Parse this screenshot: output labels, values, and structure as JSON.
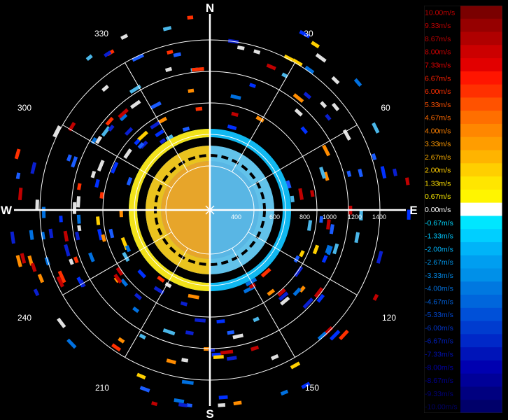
{
  "compass": {
    "north": "N",
    "east": "E",
    "south": "S",
    "west": "W"
  },
  "azimuth_labels": [
    "30",
    "60",
    "120",
    "150",
    "210",
    "240",
    "300",
    "330"
  ],
  "range_labels": [
    "400",
    "600",
    "800",
    "1000",
    "1200",
    "1400"
  ],
  "legend": {
    "labels": [
      "10.00m/s",
      "9.33m/s",
      "8.67m/s",
      "8.00m/s",
      "7.33m/s",
      "6.67m/s",
      "6.00m/s",
      "5.33m/s",
      "4.67m/s",
      "4.00m/s",
      "3.33m/s",
      "2.67m/s",
      "2.00m/s",
      "1.33m/s",
      "0.67m/s",
      "0.00m/s",
      "-0.67m/s",
      "-1.33m/s",
      "-2.00m/s",
      "-2.67m/s",
      "-3.33m/s",
      "-4.00m/s",
      "-4.67m/s",
      "-5.33m/s",
      "-6.00m/s",
      "-6.67m/s",
      "-7.33m/s",
      "-8.00m/s",
      "-8.67m/s",
      "-9.33m/s",
      "-10.00m/s"
    ],
    "colors": [
      "#7a0000",
      "#960000",
      "#b00000",
      "#cc0000",
      "#e20000",
      "#ff1500",
      "#ff3000",
      "#ff5200",
      "#ff6f00",
      "#ff8700",
      "#ff9d00",
      "#ffb400",
      "#ffcf00",
      "#ffe600",
      "#fff500",
      "#ffffff",
      "#00e6ff",
      "#00cfff",
      "#00b4f8",
      "#009ef0",
      "#0090e8",
      "#0078e0",
      "#0066dc",
      "#0050d8",
      "#003ccf",
      "#0028c8",
      "#0014b8",
      "#0000b0",
      "#000098",
      "#000080",
      "#00006a"
    ],
    "label_colors": [
      "#c00000",
      "#c00000",
      "#c00000",
      "#d00000",
      "#e00000",
      "#ff2000",
      "#ff3000",
      "#ff5000",
      "#ff6a00",
      "#ff8000",
      "#ff9a00",
      "#ffb000",
      "#ffcc00",
      "#ffe000",
      "#ffee00",
      "#ffffff",
      "#00d8ff",
      "#00c8ff",
      "#00b0f5",
      "#0098ee",
      "#0088e6",
      "#0070de",
      "#0060da",
      "#0048d2",
      "#0034c8",
      "#0020c0",
      "#0010b0",
      "#0000a8",
      "#000090",
      "#000078",
      "#000064"
    ]
  }
}
